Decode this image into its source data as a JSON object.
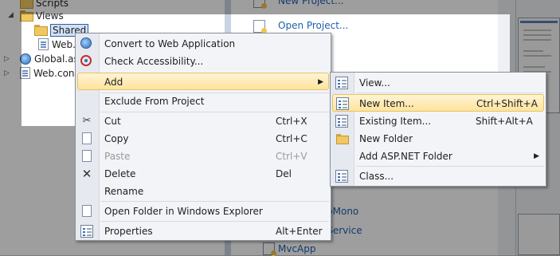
{
  "tree": {
    "items": [
      {
        "label": "Scripts"
      },
      {
        "label": "Views"
      },
      {
        "label": "Shared"
      },
      {
        "label": "Web.c"
      },
      {
        "label": "Global.as"
      },
      {
        "label": "Web.con"
      }
    ]
  },
  "start_page": {
    "links": [
      {
        "label": "New Project..."
      },
      {
        "label": "Open Project..."
      },
      {
        "label": "pMono"
      },
      {
        "label": "sService"
      },
      {
        "label": "MvcApp"
      }
    ]
  },
  "context_menu": {
    "items": [
      {
        "label": "Convert to Web Application",
        "shortcut": "",
        "icon": "web-icon"
      },
      {
        "label": "Check Accessibility...",
        "shortcut": "",
        "icon": "accessibility-icon"
      },
      {
        "label": "Add",
        "shortcut": "",
        "icon": ""
      },
      {
        "label": "Exclude From Project",
        "shortcut": "",
        "icon": ""
      },
      {
        "label": "Cut",
        "shortcut": "Ctrl+X",
        "icon": "scissors-icon"
      },
      {
        "label": "Copy",
        "shortcut": "Ctrl+C",
        "icon": "copy-icon"
      },
      {
        "label": "Paste",
        "shortcut": "Ctrl+V",
        "icon": "paste-icon"
      },
      {
        "label": "Delete",
        "shortcut": "Del",
        "icon": "delete-icon"
      },
      {
        "label": "Rename",
        "shortcut": "",
        "icon": ""
      },
      {
        "label": "Open Folder in Windows Explorer",
        "shortcut": "",
        "icon": "open-folder-icon"
      },
      {
        "label": "Properties",
        "shortcut": "Alt+Enter",
        "icon": "properties-icon"
      }
    ]
  },
  "add_submenu": {
    "items": [
      {
        "label": "View...",
        "shortcut": "",
        "icon": "view-icon"
      },
      {
        "label": "New Item...",
        "shortcut": "Ctrl+Shift+A",
        "icon": "new-item-icon"
      },
      {
        "label": "Existing Item...",
        "shortcut": "Shift+Alt+A",
        "icon": "existing-item-icon"
      },
      {
        "label": "New Folder",
        "shortcut": "",
        "icon": "folder-icon"
      },
      {
        "label": "Add ASP.NET Folder",
        "shortcut": "",
        "icon": ""
      },
      {
        "label": "Class...",
        "shortcut": "",
        "icon": "class-icon"
      }
    ]
  },
  "colors": {
    "highlight": "#fde39c",
    "link": "#1f5fb0",
    "menu_bg": "#f2f4f8"
  }
}
